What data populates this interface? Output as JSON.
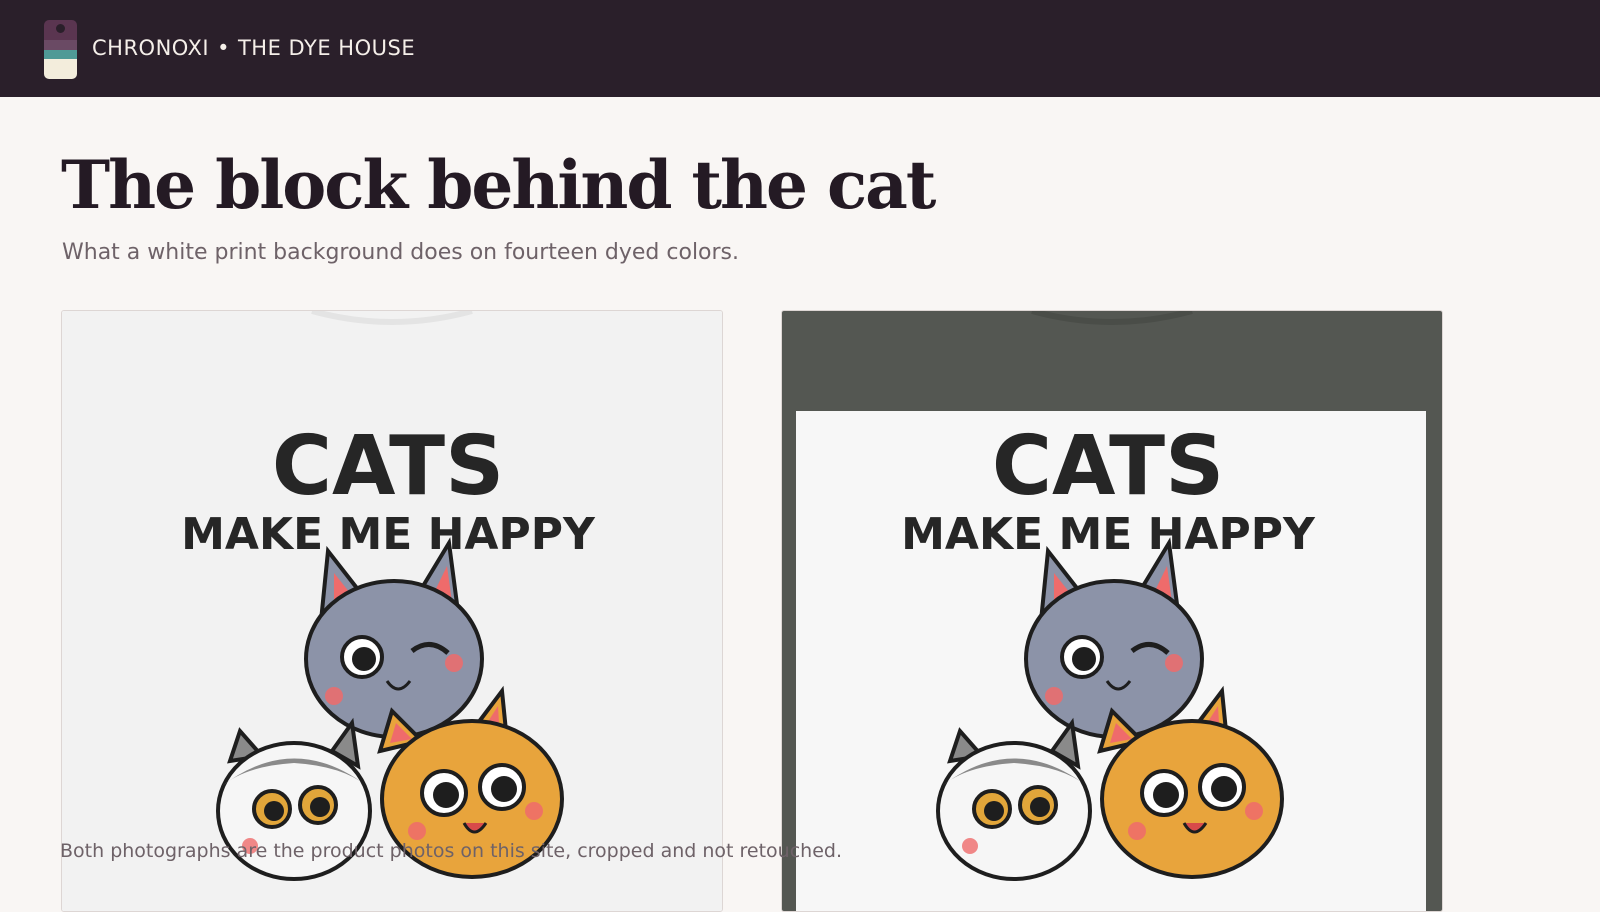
{
  "header": {
    "brand_name": "CHRONOXI",
    "separator": "•",
    "section_name": "THE DYE HOUSE",
    "logo_colors": [
      "#5a3550",
      "#6a4a64",
      "#4f9a96",
      "#f3eddc"
    ]
  },
  "page": {
    "title": "The block behind the cat",
    "subtitle": "What a white print background does on fourteen dyed colors."
  },
  "photos": [
    {
      "shirt_color": "#f2f2f2",
      "print_background": "none",
      "print_line1": "CATS",
      "print_line2": "MAKE ME HAPPY"
    },
    {
      "shirt_color": "#545752",
      "print_background": "#f7f7f7",
      "print_line1": "CATS",
      "print_line2": "MAKE ME HAPPY"
    }
  ],
  "caption": "Both photographs are the product photos on this site, cropped and not retouched."
}
